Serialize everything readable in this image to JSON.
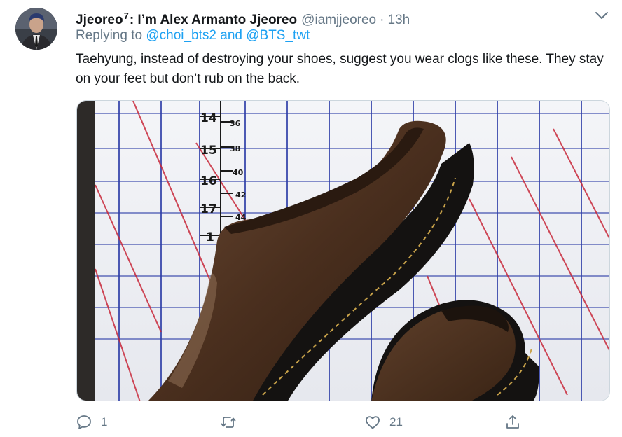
{
  "author": {
    "display_name_before": "Jjeoreo",
    "display_name_sup": "7",
    "display_name_after": ": I’m Alex Armanto Jjeoreo",
    "handle": "@iamjjeoreo",
    "separator": "·",
    "time": "13h"
  },
  "reply": {
    "prefix": "Replying to",
    "mention_1": "@choi_bts2",
    "conjunction": "and",
    "mention_2": "@BTS_twt"
  },
  "tweet_text": "Taehyung, instead of destroying your shoes, suggest you wear clogs like these. They stay on your feet but don’t rub on the back.",
  "media": {
    "ruler_inch_labels": [
      "14",
      "15",
      "16",
      "17",
      "1"
    ],
    "ruler_size_labels": [
      "36",
      "38",
      "40",
      "42",
      "44"
    ]
  },
  "actions": {
    "reply_count": "1",
    "retweet_count": "",
    "like_count": "21"
  },
  "colors": {
    "link": "#1da1f2",
    "secondary_text": "#657786",
    "grid_blue": "#2f3fa8",
    "grid_red": "#c8283a",
    "shoe_brown": "#4a2f1e"
  },
  "icons": {
    "menu": "chevron-down-icon",
    "reply": "speech-bubble-icon",
    "retweet": "retweet-arrows-icon",
    "like": "heart-icon",
    "share": "share-upload-icon"
  }
}
